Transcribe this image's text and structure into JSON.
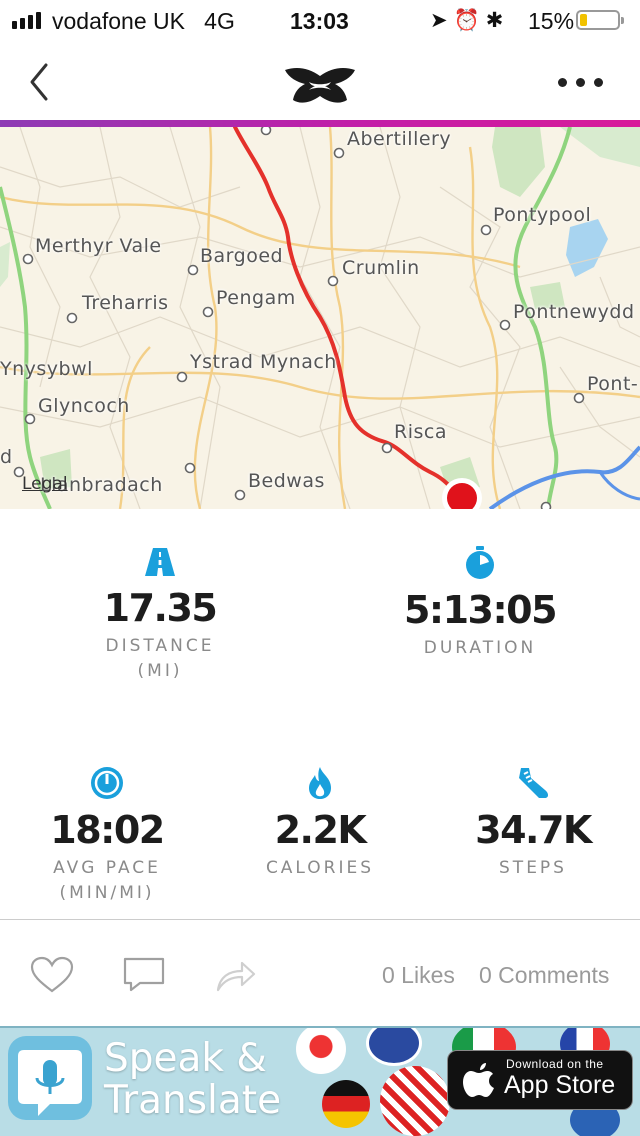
{
  "status_bar": {
    "carrier": "vodafone UK",
    "network": "4G",
    "time": "13:03",
    "battery": "15%"
  },
  "nav": {
    "back_icon": "chevron-left-icon",
    "logo": "under-armour-logo",
    "more_icon": "more-dots-icon"
  },
  "colors": {
    "accent_start": "#8e3bb4",
    "accent_end": "#d81b9a",
    "stat_icon": "#1aa0dc",
    "route": "#e4312b"
  },
  "map": {
    "places": [
      "Abertillery",
      "Pontypool",
      "Merthyr Vale",
      "Bargoed",
      "Crumlin",
      "Treharris",
      "Pengam",
      "Pontnewydd",
      "Ynysybwl",
      "Ystrad Mynach",
      "Pont-",
      "Glyncoch",
      "Risca",
      "d",
      "Llanbradach",
      "Bedwas"
    ],
    "legal": "Legal"
  },
  "stats": {
    "distance": {
      "value": "17.35",
      "label": "DISTANCE",
      "unit": "(MI)",
      "icon": "road-icon"
    },
    "duration": {
      "value": "5:13:05",
      "label": "DURATION",
      "icon": "stopwatch-icon"
    },
    "pace": {
      "value": "18:02",
      "label": "AVG PACE",
      "unit": "(MIN/MI)",
      "icon": "speedometer-icon"
    },
    "calories": {
      "value": "2.2K",
      "label": "CALORIES",
      "icon": "flame-icon"
    },
    "steps": {
      "value": "34.7K",
      "label": "STEPS",
      "icon": "shoe-icon"
    }
  },
  "actions": {
    "like_icon": "heart-icon",
    "comment_icon": "comment-icon",
    "share_icon": "share-icon",
    "likes": "0 Likes",
    "comments": "0 Comments"
  },
  "ad": {
    "title_line1": "Speak &",
    "title_line2": "Translate",
    "badge_small": "Download on the",
    "badge_big": "App Store"
  }
}
